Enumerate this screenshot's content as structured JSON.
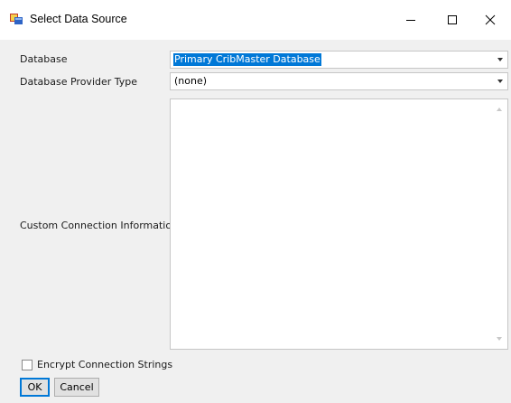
{
  "window": {
    "title": "Select Data Source",
    "icon": "database-app-icon",
    "controls": {
      "minimize": "minimize-icon",
      "maximize": "maximize-icon",
      "close": "close-icon"
    }
  },
  "form": {
    "database": {
      "label": "Database",
      "value": "Primary CribMaster Database"
    },
    "provider_type": {
      "label": "Database Provider Type",
      "value": "(none)"
    },
    "custom_connection": {
      "label": "Custom Connection Information",
      "value": ""
    },
    "encrypt": {
      "label": "Encrypt Connection Strings",
      "checked": false
    }
  },
  "buttons": {
    "ok": "OK",
    "cancel": "Cancel"
  },
  "colors": {
    "selection": "#0078d7",
    "background": "#f0f0f0"
  }
}
